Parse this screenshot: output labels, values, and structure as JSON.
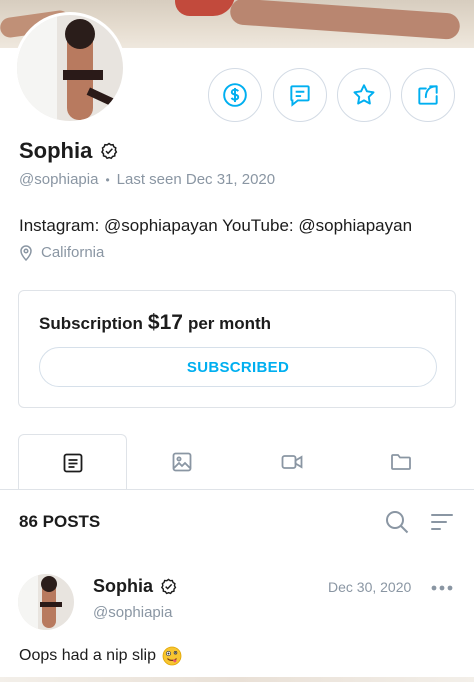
{
  "profile": {
    "name": "Sophia",
    "handle": "@sophiapia",
    "last_seen": "Last seen Dec 31, 2020",
    "bio": "Instagram: @sophiapayan YouTube: @sophiapayan",
    "location": "California"
  },
  "actions": {
    "tip_icon": "dollar-circle-icon",
    "message_icon": "message-icon",
    "favorite_icon": "star-icon",
    "share_icon": "share-icon"
  },
  "subscription": {
    "label_prefix": "Subscription",
    "price": "$17",
    "label_suffix": "per month",
    "button_label": "SUBSCRIBED"
  },
  "tabs": [
    {
      "name": "posts",
      "icon": "posts-icon",
      "active": true
    },
    {
      "name": "photos",
      "icon": "photo-icon",
      "active": false
    },
    {
      "name": "videos",
      "icon": "video-icon",
      "active": false
    },
    {
      "name": "archive",
      "icon": "folder-icon",
      "active": false
    }
  ],
  "posts_header": {
    "count_label": "86 POSTS"
  },
  "post": {
    "author": "Sophia",
    "handle": "@sophiapia",
    "date": "Dec 30, 2020",
    "text": "Oops had a nip slip"
  },
  "colors": {
    "accent": "#00aff0",
    "muted": "#8a96a3",
    "border": "#dfe3e8"
  }
}
